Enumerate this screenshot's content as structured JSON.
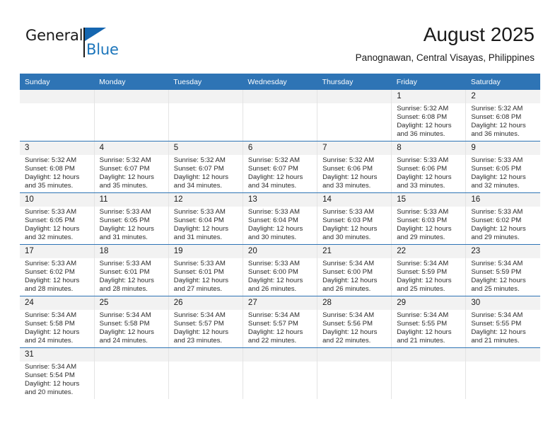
{
  "brand": {
    "name_part1": "General",
    "name_part2": "Blue",
    "logo_icon": "blue-triangle-flag",
    "color_black": "#1a1a1a",
    "color_blue": "#1b75bb"
  },
  "header": {
    "title": "August 2025",
    "subtitle": "Panognawan, Central Visayas, Philippines"
  },
  "theme": {
    "header_blue": "#2e74b5",
    "daynum_bg": "#f2f2f2",
    "grid_line": "#e4e4e4"
  },
  "weekdays": [
    "Sunday",
    "Monday",
    "Tuesday",
    "Wednesday",
    "Thursday",
    "Friday",
    "Saturday"
  ],
  "weeks": [
    [
      {
        "day": "",
        "empty": true
      },
      {
        "day": "",
        "empty": true
      },
      {
        "day": "",
        "empty": true
      },
      {
        "day": "",
        "empty": true
      },
      {
        "day": "",
        "empty": true
      },
      {
        "day": "1",
        "sunrise": "Sunrise: 5:32 AM",
        "sunset": "Sunset: 6:08 PM",
        "daylight1": "Daylight: 12 hours",
        "daylight2": "and 36 minutes."
      },
      {
        "day": "2",
        "sunrise": "Sunrise: 5:32 AM",
        "sunset": "Sunset: 6:08 PM",
        "daylight1": "Daylight: 12 hours",
        "daylight2": "and 36 minutes."
      }
    ],
    [
      {
        "day": "3",
        "sunrise": "Sunrise: 5:32 AM",
        "sunset": "Sunset: 6:08 PM",
        "daylight1": "Daylight: 12 hours",
        "daylight2": "and 35 minutes."
      },
      {
        "day": "4",
        "sunrise": "Sunrise: 5:32 AM",
        "sunset": "Sunset: 6:07 PM",
        "daylight1": "Daylight: 12 hours",
        "daylight2": "and 35 minutes."
      },
      {
        "day": "5",
        "sunrise": "Sunrise: 5:32 AM",
        "sunset": "Sunset: 6:07 PM",
        "daylight1": "Daylight: 12 hours",
        "daylight2": "and 34 minutes."
      },
      {
        "day": "6",
        "sunrise": "Sunrise: 5:32 AM",
        "sunset": "Sunset: 6:07 PM",
        "daylight1": "Daylight: 12 hours",
        "daylight2": "and 34 minutes."
      },
      {
        "day": "7",
        "sunrise": "Sunrise: 5:32 AM",
        "sunset": "Sunset: 6:06 PM",
        "daylight1": "Daylight: 12 hours",
        "daylight2": "and 33 minutes."
      },
      {
        "day": "8",
        "sunrise": "Sunrise: 5:33 AM",
        "sunset": "Sunset: 6:06 PM",
        "daylight1": "Daylight: 12 hours",
        "daylight2": "and 33 minutes."
      },
      {
        "day": "9",
        "sunrise": "Sunrise: 5:33 AM",
        "sunset": "Sunset: 6:05 PM",
        "daylight1": "Daylight: 12 hours",
        "daylight2": "and 32 minutes."
      }
    ],
    [
      {
        "day": "10",
        "sunrise": "Sunrise: 5:33 AM",
        "sunset": "Sunset: 6:05 PM",
        "daylight1": "Daylight: 12 hours",
        "daylight2": "and 32 minutes."
      },
      {
        "day": "11",
        "sunrise": "Sunrise: 5:33 AM",
        "sunset": "Sunset: 6:05 PM",
        "daylight1": "Daylight: 12 hours",
        "daylight2": "and 31 minutes."
      },
      {
        "day": "12",
        "sunrise": "Sunrise: 5:33 AM",
        "sunset": "Sunset: 6:04 PM",
        "daylight1": "Daylight: 12 hours",
        "daylight2": "and 31 minutes."
      },
      {
        "day": "13",
        "sunrise": "Sunrise: 5:33 AM",
        "sunset": "Sunset: 6:04 PM",
        "daylight1": "Daylight: 12 hours",
        "daylight2": "and 30 minutes."
      },
      {
        "day": "14",
        "sunrise": "Sunrise: 5:33 AM",
        "sunset": "Sunset: 6:03 PM",
        "daylight1": "Daylight: 12 hours",
        "daylight2": "and 30 minutes."
      },
      {
        "day": "15",
        "sunrise": "Sunrise: 5:33 AM",
        "sunset": "Sunset: 6:03 PM",
        "daylight1": "Daylight: 12 hours",
        "daylight2": "and 29 minutes."
      },
      {
        "day": "16",
        "sunrise": "Sunrise: 5:33 AM",
        "sunset": "Sunset: 6:02 PM",
        "daylight1": "Daylight: 12 hours",
        "daylight2": "and 29 minutes."
      }
    ],
    [
      {
        "day": "17",
        "sunrise": "Sunrise: 5:33 AM",
        "sunset": "Sunset: 6:02 PM",
        "daylight1": "Daylight: 12 hours",
        "daylight2": "and 28 minutes."
      },
      {
        "day": "18",
        "sunrise": "Sunrise: 5:33 AM",
        "sunset": "Sunset: 6:01 PM",
        "daylight1": "Daylight: 12 hours",
        "daylight2": "and 28 minutes."
      },
      {
        "day": "19",
        "sunrise": "Sunrise: 5:33 AM",
        "sunset": "Sunset: 6:01 PM",
        "daylight1": "Daylight: 12 hours",
        "daylight2": "and 27 minutes."
      },
      {
        "day": "20",
        "sunrise": "Sunrise: 5:33 AM",
        "sunset": "Sunset: 6:00 PM",
        "daylight1": "Daylight: 12 hours",
        "daylight2": "and 26 minutes."
      },
      {
        "day": "21",
        "sunrise": "Sunrise: 5:34 AM",
        "sunset": "Sunset: 6:00 PM",
        "daylight1": "Daylight: 12 hours",
        "daylight2": "and 26 minutes."
      },
      {
        "day": "22",
        "sunrise": "Sunrise: 5:34 AM",
        "sunset": "Sunset: 5:59 PM",
        "daylight1": "Daylight: 12 hours",
        "daylight2": "and 25 minutes."
      },
      {
        "day": "23",
        "sunrise": "Sunrise: 5:34 AM",
        "sunset": "Sunset: 5:59 PM",
        "daylight1": "Daylight: 12 hours",
        "daylight2": "and 25 minutes."
      }
    ],
    [
      {
        "day": "24",
        "sunrise": "Sunrise: 5:34 AM",
        "sunset": "Sunset: 5:58 PM",
        "daylight1": "Daylight: 12 hours",
        "daylight2": "and 24 minutes."
      },
      {
        "day": "25",
        "sunrise": "Sunrise: 5:34 AM",
        "sunset": "Sunset: 5:58 PM",
        "daylight1": "Daylight: 12 hours",
        "daylight2": "and 24 minutes."
      },
      {
        "day": "26",
        "sunrise": "Sunrise: 5:34 AM",
        "sunset": "Sunset: 5:57 PM",
        "daylight1": "Daylight: 12 hours",
        "daylight2": "and 23 minutes."
      },
      {
        "day": "27",
        "sunrise": "Sunrise: 5:34 AM",
        "sunset": "Sunset: 5:57 PM",
        "daylight1": "Daylight: 12 hours",
        "daylight2": "and 22 minutes."
      },
      {
        "day": "28",
        "sunrise": "Sunrise: 5:34 AM",
        "sunset": "Sunset: 5:56 PM",
        "daylight1": "Daylight: 12 hours",
        "daylight2": "and 22 minutes."
      },
      {
        "day": "29",
        "sunrise": "Sunrise: 5:34 AM",
        "sunset": "Sunset: 5:55 PM",
        "daylight1": "Daylight: 12 hours",
        "daylight2": "and 21 minutes."
      },
      {
        "day": "30",
        "sunrise": "Sunrise: 5:34 AM",
        "sunset": "Sunset: 5:55 PM",
        "daylight1": "Daylight: 12 hours",
        "daylight2": "and 21 minutes."
      }
    ],
    [
      {
        "day": "31",
        "sunrise": "Sunrise: 5:34 AM",
        "sunset": "Sunset: 5:54 PM",
        "daylight1": "Daylight: 12 hours",
        "daylight2": "and 20 minutes."
      },
      {
        "day": "",
        "empty": true
      },
      {
        "day": "",
        "empty": true
      },
      {
        "day": "",
        "empty": true
      },
      {
        "day": "",
        "empty": true
      },
      {
        "day": "",
        "empty": true
      },
      {
        "day": "",
        "empty": true
      }
    ]
  ]
}
